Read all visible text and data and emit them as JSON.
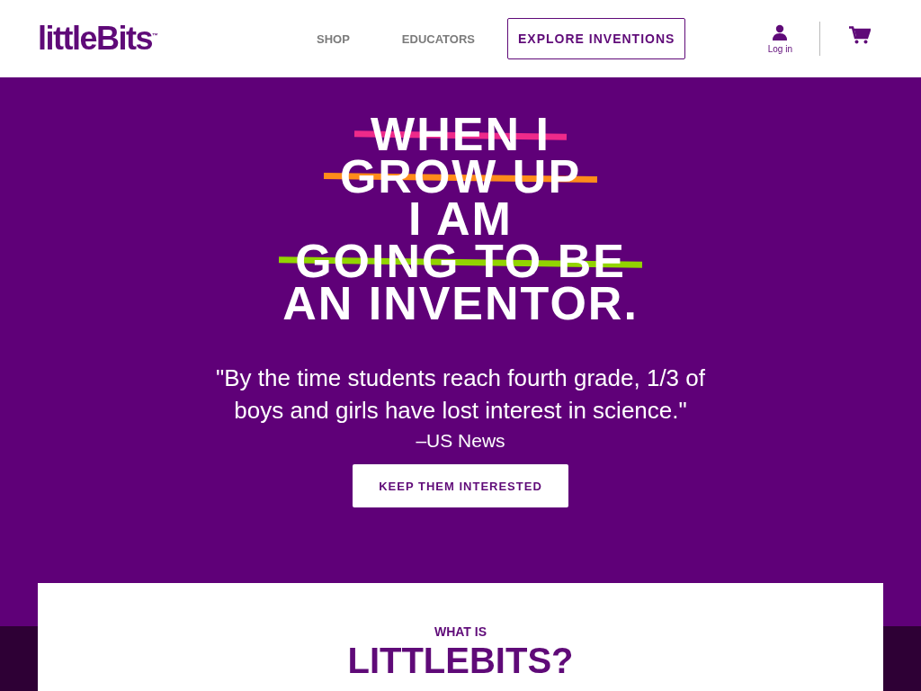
{
  "header": {
    "logo": "littleBits",
    "logo_mark": "™",
    "nav": [
      {
        "label": "SHOP",
        "kind": "link"
      },
      {
        "label": "EDUCATORS",
        "kind": "link"
      },
      {
        "label": "EXPLORE INVENTIONS",
        "kind": "outlined"
      }
    ],
    "login": "Log in"
  },
  "hero": {
    "headline": [
      {
        "text": "WHEN I",
        "struck": true,
        "color": "#ee2a8a"
      },
      {
        "text": "GROW UP",
        "struck": true,
        "color": "#ff8c1a"
      },
      {
        "text": "I AM",
        "struck": false
      },
      {
        "text": "GOING TO BE",
        "struck": true,
        "color": "#92d400"
      },
      {
        "text": "AN INVENTOR.",
        "struck": false
      }
    ],
    "quote": "\"By the time students reach fourth grade, 1/3 of boys and girls have lost interest in science.\"",
    "source": "–US News",
    "button": "KEEP THEM INTERESTED"
  },
  "card": {
    "eyebrow": "WHAT IS",
    "title": "LITTLEBITS?"
  }
}
